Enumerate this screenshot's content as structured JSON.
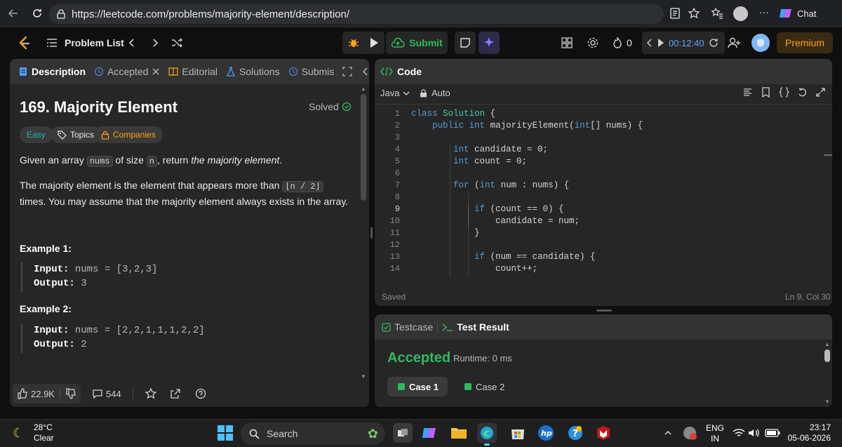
{
  "browser": {
    "url": "https://leetcode.com/problems/majority-element/description/",
    "chat_label": "Chat",
    "more_label": "···"
  },
  "nav": {
    "problem_list": "Problem List",
    "submit": "Submit",
    "streak": "0",
    "timer": "00:12:40",
    "premium": "Premium"
  },
  "left_tabs": [
    {
      "label": "Description",
      "icon": "document-icon"
    },
    {
      "label": "Accepted",
      "icon": "history-icon"
    },
    {
      "label": "Editorial",
      "icon": "book-icon"
    },
    {
      "label": "Solutions",
      "icon": "flask-icon"
    },
    {
      "label": "Submis",
      "icon": "history-icon"
    }
  ],
  "problem": {
    "title": "169. Majority Element",
    "status": "Solved",
    "difficulty": "Easy",
    "topics": "Topics",
    "companies": "Companies",
    "desc1_a": "Given an array ",
    "desc1_code1": "nums",
    "desc1_b": " of size ",
    "desc1_code2": "n",
    "desc1_c": ", return ",
    "desc1_em": "the majority element",
    "desc1_d": ".",
    "desc2_a": "The majority element is the element that appears more than ",
    "desc2_code": "⌊n / 2⌋",
    "desc2_b": " times. You may assume that the majority element always exists in the array.",
    "examples": [
      {
        "heading": "Example 1:",
        "input_label": "Input:",
        "input": "nums = [3,2,3]",
        "output_label": "Output:",
        "output": "3"
      },
      {
        "heading": "Example 2:",
        "input_label": "Input:",
        "input": "nums = [2,2,1,1,1,2,2]",
        "output_label": "Output:",
        "output": "2"
      }
    ]
  },
  "footer": {
    "likes": "22.9K",
    "comments": "544"
  },
  "code": {
    "tab_label": "Code",
    "language": "Java",
    "auto": "Auto",
    "saved": "Saved",
    "cursor": "Ln 9, Col 30",
    "lines": [
      {
        "n": "1",
        "text": "class Solution {"
      },
      {
        "n": "2",
        "text": "    public int majorityElement(int[] nums) {"
      },
      {
        "n": "3",
        "text": ""
      },
      {
        "n": "4",
        "text": "        int candidate = 0;"
      },
      {
        "n": "5",
        "text": "        int count = 0;"
      },
      {
        "n": "6",
        "text": ""
      },
      {
        "n": "7",
        "text": "        for (int num : nums) {"
      },
      {
        "n": "8",
        "text": ""
      },
      {
        "n": "9",
        "text": "            if (count == 0) {"
      },
      {
        "n": "10",
        "text": "                candidate = num;"
      },
      {
        "n": "11",
        "text": "            }"
      },
      {
        "n": "12",
        "text": ""
      },
      {
        "n": "13",
        "text": "            if (num == candidate) {"
      },
      {
        "n": "14",
        "text": "                count++;"
      }
    ]
  },
  "result": {
    "testcase_tab": "Testcase",
    "result_tab": "Test Result",
    "status": "Accepted",
    "runtime": "Runtime: 0 ms",
    "cases": [
      "Case 1",
      "Case 2"
    ]
  },
  "taskbar": {
    "temp": "28°C",
    "weather": "Clear",
    "search": "Search",
    "lang1": "ENG",
    "lang2": "IN",
    "time": "23:17",
    "date": "05-06-2026"
  },
  "colors": {
    "accent_green": "#2cbb5d",
    "easy": "#1cbaba",
    "premium": "#ffa116",
    "timer_blue": "#5ea8ff"
  }
}
